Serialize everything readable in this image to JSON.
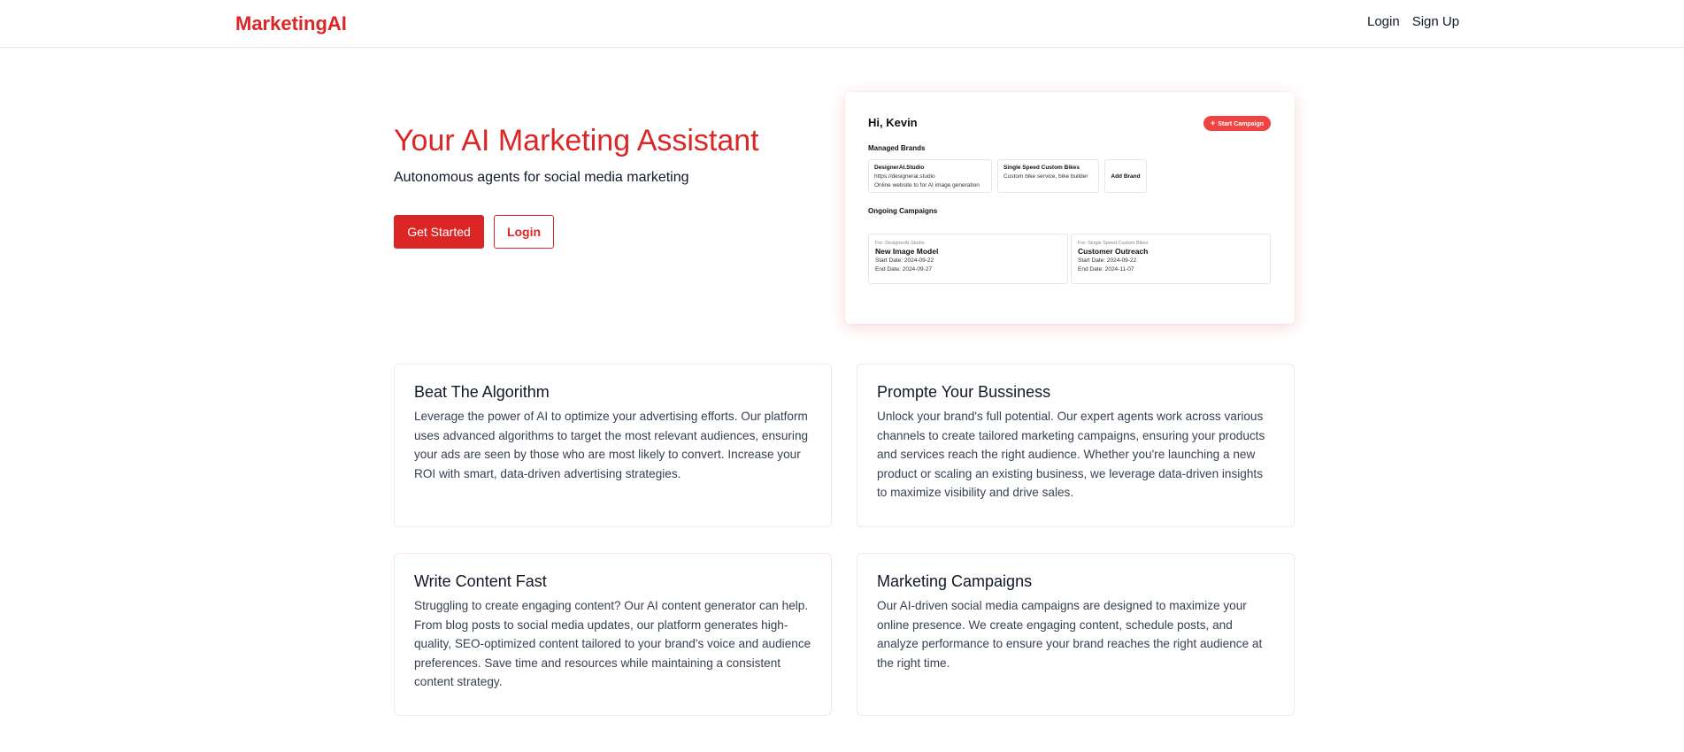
{
  "nav": {
    "logo": "MarketingAI",
    "login": "Login",
    "signup": "Sign Up"
  },
  "hero": {
    "title": "Your AI Marketing Assistant",
    "subtitle": "Autonomous agents for social media marketing",
    "get_started": "Get Started",
    "login": "Login"
  },
  "preview": {
    "greeting": "Hi, Kevin",
    "start_campaign": "Start Campaign",
    "start_campaign_icon": "plus-icon",
    "managed_brands_title": "Managed Brands",
    "brands": [
      {
        "name": "DesignerAI.Studio",
        "url": "https://designerai.studio",
        "desc": "Online website to for AI image generation"
      },
      {
        "name": "Single Speed Custom Bikes",
        "desc": "Custom bike service, bike builder"
      }
    ],
    "add_brand": "Add Brand",
    "ongoing_title": "Ongoing Campaigns",
    "campaigns": [
      {
        "for": "For: DesignerAI.Studio",
        "name": "New Image Model",
        "start": "Start Date: 2024-09-22",
        "end": "End Date: 2024-09-27"
      },
      {
        "for": "For: Single Speed Custom Bikes",
        "name": "Customer Outreach",
        "start": "Start Date: 2024-09-22",
        "end": "End Date: 2024-11-07"
      }
    ]
  },
  "features": [
    {
      "title": "Beat The Algorithm",
      "text": "Leverage the power of AI to optimize your advertising efforts. Our platform uses advanced algorithms to target the most relevant audiences, ensuring your ads are seen by those who are most likely to convert. Increase your ROI with smart, data-driven advertising strategies."
    },
    {
      "title": "Prompte Your Bussiness",
      "text": "Unlock your brand's full potential. Our expert agents work across various channels to create tailored marketing campaigns, ensuring your products and services reach the right audience. Whether you're launching a new product or scaling an existing business, we leverage data-driven insights to maximize visibility and drive sales."
    },
    {
      "title": "Write Content Fast",
      "text": "Struggling to create engaging content? Our AI content generator can help. From blog posts to social media updates, our platform generates high-quality, SEO-optimized content tailored to your brand's voice and audience preferences. Save time and resources while maintaining a consistent content strategy."
    },
    {
      "title": "Marketing Campaigns",
      "text": "Our AI-driven social media campaigns are designed to maximize your online presence. We create engaging content, schedule posts, and analyze performance to ensure your brand reaches the right audience at the right time."
    }
  ],
  "colors": {
    "brand": "#dc2626",
    "accent_button": "#ef4444"
  }
}
